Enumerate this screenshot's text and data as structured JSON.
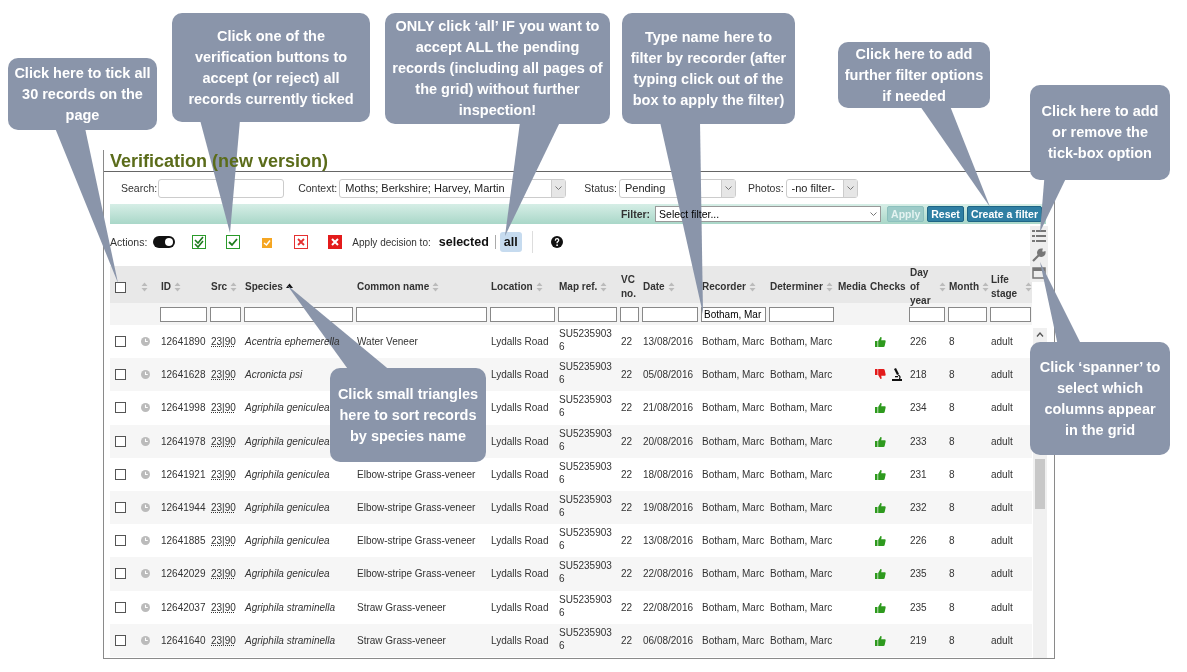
{
  "title": "Verification (new version)",
  "search": {
    "label": "Search:"
  },
  "context": {
    "label": "Context:",
    "value": "Moths; Berkshire; Harvey, Martin"
  },
  "status": {
    "label": "Status:",
    "value": "Pending"
  },
  "photos": {
    "label": "Photos:",
    "value": "-no filter-"
  },
  "filter_bar": {
    "label": "Filter:",
    "placeholder": "Select filter...",
    "buttons": [
      {
        "label": "Apply",
        "disabled": true
      },
      {
        "label": "Reset",
        "disabled": false
      },
      {
        "label": "Create a filter",
        "disabled": false
      }
    ]
  },
  "actions": {
    "label": "Actions:",
    "toggle_on": true,
    "decisions": [
      {
        "kind": "verified_plus"
      },
      {
        "kind": "verified"
      },
      {
        "kind": "plausible"
      },
      {
        "kind": "doubtful"
      },
      {
        "kind": "rejected"
      }
    ],
    "apply_label": "Apply decision to:",
    "scopes": [
      {
        "label": "selected",
        "selected": false
      },
      {
        "label": "all",
        "selected": true
      }
    ]
  },
  "columns": [
    {
      "kind": "checkbox",
      "checked": false
    },
    {
      "kind": "status",
      "sortable": true,
      "sorted": false,
      "filter": false
    },
    {
      "label": "ID",
      "sortable": true,
      "sorted": false,
      "filter": true
    },
    {
      "label": "Src",
      "sortable": true,
      "sorted": false,
      "filter": true
    },
    {
      "label": "Species",
      "sortable": true,
      "sorted": true,
      "filter": true
    },
    {
      "label": "Common name",
      "sortable": true,
      "sorted": false,
      "filter": true
    },
    {
      "label": "Location",
      "sortable": true,
      "sorted": false,
      "filter": true
    },
    {
      "label": "Map ref.",
      "sortable": true,
      "sorted": false,
      "filter": true
    },
    {
      "label": "VC no.",
      "sortable": false,
      "filter": true
    },
    {
      "label": "Date",
      "sortable": true,
      "sorted": false,
      "filter": true
    },
    {
      "label": "Recorder",
      "sortable": true,
      "sorted": false,
      "filter": true,
      "filter_value": "Botham, Mar"
    },
    {
      "label": "Determiner",
      "sortable": true,
      "sorted": false,
      "filter": true
    },
    {
      "label": "Media",
      "sortable": false,
      "filter": false
    },
    {
      "label": "Checks",
      "sortable": false,
      "filter": false
    },
    {
      "label": "Day of year",
      "sortable": true,
      "sorted": false,
      "filter": true
    },
    {
      "label": "Month",
      "sortable": true,
      "sorted": false,
      "filter": true
    },
    {
      "label": "Life stage",
      "sortable": true,
      "sorted": false,
      "filter": true
    }
  ],
  "rows": [
    {
      "checked": false,
      "id": "12641890",
      "src": "23|90",
      "species": "Acentria ephemerella",
      "common_name": "Water Veneer",
      "location": "Lydalls Road",
      "map_ref": "SU52359036",
      "vc": "22",
      "date": "13/08/2016",
      "recorder": "Botham, Marc",
      "determiner": "Botham, Marc",
      "checks": [
        {
          "kind": "pass"
        }
      ],
      "day_of_year": "226",
      "month": "8",
      "life_stage": "adult"
    },
    {
      "checked": false,
      "id": "12641628",
      "src": "23|90",
      "species": "Acronicta psi",
      "location": "Lydalls Road",
      "map_ref": "SU52359036",
      "vc": "22",
      "date": "05/08/2016",
      "recorder": "Botham, Marc",
      "determiner": "Botham, Marc",
      "checks": [
        {
          "kind": "fail"
        },
        {
          "kind": "identification"
        }
      ],
      "day_of_year": "218",
      "month": "8",
      "life_stage": "adult"
    },
    {
      "checked": false,
      "id": "12641998",
      "src": "23|90",
      "species": "Agriphila geniculea",
      "location": "Lydalls Road",
      "map_ref": "SU52359036",
      "vc": "22",
      "date": "21/08/2016",
      "recorder": "Botham, Marc",
      "determiner": "Botham, Marc",
      "checks": [
        {
          "kind": "pass"
        }
      ],
      "day_of_year": "234",
      "month": "8",
      "life_stage": "adult"
    },
    {
      "checked": false,
      "id": "12641978",
      "src": "23|90",
      "species": "Agriphila geniculea",
      "location": "Lydalls Road",
      "map_ref": "SU52359036",
      "vc": "22",
      "date": "20/08/2016",
      "recorder": "Botham, Marc",
      "determiner": "Botham, Marc",
      "checks": [
        {
          "kind": "pass"
        }
      ],
      "day_of_year": "233",
      "month": "8",
      "life_stage": "adult"
    },
    {
      "checked": false,
      "id": "12641921",
      "src": "23|90",
      "species": "Agriphila geniculea",
      "common_name": "Elbow-stripe Grass-veneer",
      "location": "Lydalls Road",
      "map_ref": "SU52359036",
      "vc": "22",
      "date": "18/08/2016",
      "recorder": "Botham, Marc",
      "determiner": "Botham, Marc",
      "checks": [
        {
          "kind": "pass"
        }
      ],
      "day_of_year": "231",
      "month": "8",
      "life_stage": "adult"
    },
    {
      "checked": false,
      "id": "12641944",
      "src": "23|90",
      "species": "Agriphila geniculea",
      "common_name": "Elbow-stripe Grass-veneer",
      "location": "Lydalls Road",
      "map_ref": "SU52359036",
      "vc": "22",
      "date": "19/08/2016",
      "recorder": "Botham, Marc",
      "determiner": "Botham, Marc",
      "checks": [
        {
          "kind": "pass"
        }
      ],
      "day_of_year": "232",
      "month": "8",
      "life_stage": "adult"
    },
    {
      "checked": false,
      "id": "12641885",
      "src": "23|90",
      "species": "Agriphila geniculea",
      "common_name": "Elbow-stripe Grass-veneer",
      "location": "Lydalls Road",
      "map_ref": "SU52359036",
      "vc": "22",
      "date": "13/08/2016",
      "recorder": "Botham, Marc",
      "determiner": "Botham, Marc",
      "checks": [
        {
          "kind": "pass"
        }
      ],
      "day_of_year": "226",
      "month": "8",
      "life_stage": "adult"
    },
    {
      "checked": false,
      "id": "12642029",
      "src": "23|90",
      "species": "Agriphila geniculea",
      "common_name": "Elbow-stripe Grass-veneer",
      "location": "Lydalls Road",
      "map_ref": "SU52359036",
      "vc": "22",
      "date": "22/08/2016",
      "recorder": "Botham, Marc",
      "determiner": "Botham, Marc",
      "checks": [
        {
          "kind": "pass"
        }
      ],
      "day_of_year": "235",
      "month": "8",
      "life_stage": "adult"
    },
    {
      "checked": false,
      "id": "12642037",
      "src": "23|90",
      "species": "Agriphila straminella",
      "common_name": "Straw Grass-veneer",
      "location": "Lydalls Road",
      "map_ref": "SU52359036",
      "vc": "22",
      "date": "22/08/2016",
      "recorder": "Botham, Marc",
      "determiner": "Botham, Marc",
      "checks": [
        {
          "kind": "pass"
        }
      ],
      "day_of_year": "235",
      "month": "8",
      "life_stage": "adult"
    },
    {
      "checked": false,
      "id": "12641640",
      "src": "23|90",
      "species": "Agriphila straminella",
      "common_name": "Straw Grass-veneer",
      "location": "Lydalls Road",
      "map_ref": "SU52359036",
      "vc": "22",
      "date": "06/08/2016",
      "recorder": "Botham, Marc",
      "determiner": "Botham, Marc",
      "checks": [
        {
          "kind": "pass"
        }
      ],
      "day_of_year": "219",
      "month": "8",
      "life_stage": "adult"
    }
  ],
  "callouts": [
    {
      "text": "Click here to tick all 30 records on the page"
    },
    {
      "text": "Click one of the verification buttons to accept (or reject) all records currently ticked"
    },
    {
      "text": "ONLY click ‘all’ IF you want to accept ALL the pending records (including all pages of the grid) without further inspection!"
    },
    {
      "text": "Type name here to filter by recorder (after typing click out of the box to apply the filter)"
    },
    {
      "text": "Click here to add further filter options if needed"
    },
    {
      "text": "Click here to add or remove the tick-box option"
    },
    {
      "text": "Click small triangles here to sort records by species name"
    },
    {
      "text": "Click ‘spanner’ to select which columns appear in the grid"
    }
  ]
}
